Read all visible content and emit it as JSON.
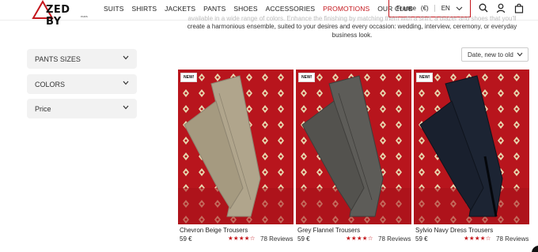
{
  "header": {
    "logo_text": "ZED BY",
    "logo_sub": "PARIS",
    "nav": [
      {
        "label": "SUITS"
      },
      {
        "label": "SHIRTS"
      },
      {
        "label": "JACKETS"
      },
      {
        "label": "PANTS"
      },
      {
        "label": "SHOES"
      },
      {
        "label": "ACCESSORIES"
      },
      {
        "label": "PROMOTIONS"
      },
      {
        "label": "OUR CLUB"
      }
    ],
    "country": "France",
    "currency": "(€)",
    "language": "EN",
    "colors": {
      "accent": "#c4161c"
    }
  },
  "description": {
    "line1": "available in a wide range of colors. Enhance the finishing by matching them with a shirt, a blazer and shoes that you'll",
    "line2": "create a harmonious ensemble, suited to your desires and every occasion: wedding, interview, ceremony, or everyday",
    "line3": "business look."
  },
  "filters": [
    {
      "label": "PANTS SIZES"
    },
    {
      "label": "COLORS"
    },
    {
      "label": "Price"
    }
  ],
  "sort": {
    "label": "Date, new to old"
  },
  "products": [
    {
      "badge": "NEW!",
      "name": "Chevron Beige Trousers",
      "price": "59 €",
      "stars": "★★★★☆",
      "reviews": "78 Reviews",
      "rating": 4.5,
      "pant_color": "#b0a58c"
    },
    {
      "badge": "NEW!",
      "name": "Grey Flannel Trousers",
      "price": "59 €",
      "stars": "★★★★☆",
      "reviews": "78 Reviews",
      "rating": 4.5,
      "pant_color": "#5d5c58"
    },
    {
      "badge": "NEW!",
      "name": "Sylvio Navy Dress Trousers",
      "price": "59 €",
      "stars": "★★★★☆",
      "reviews": "78 Reviews",
      "rating": 4.5,
      "pant_color": "#1c2433"
    }
  ]
}
